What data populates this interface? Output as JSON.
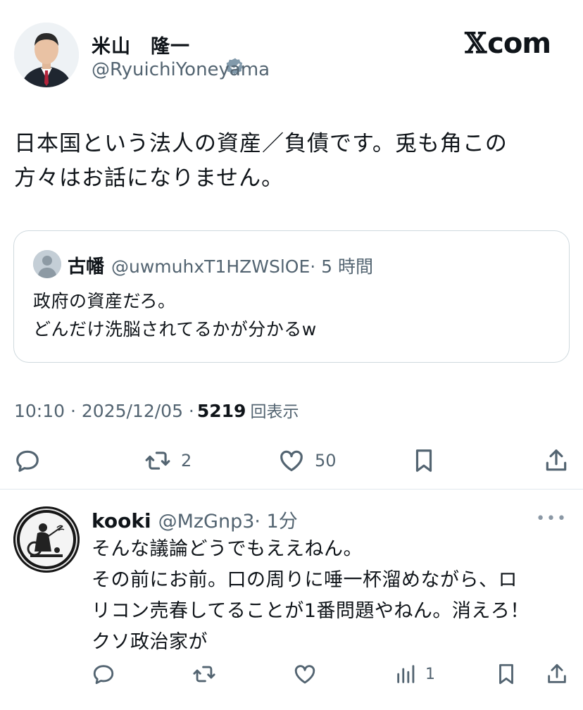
{
  "tweet": {
    "author_name": "米山　隆一",
    "author_handle": "@RyuichiYoneyama",
    "brand": "com",
    "brand_mark": "𝕏",
    "text_line1": "日本国という法人の資産／負債です。兎も角この",
    "text_line2": "方々はお話になりません。",
    "quote": {
      "name": "古幡",
      "handle": "@uwmuhxT1HZWSlOE",
      "time": "· 5 時間",
      "body_line1": "政府の資産だろ。",
      "body_line2": "どんだけ洗脳されてるかが分かるw"
    },
    "timestamp": "10:10 · 2025/12/05 · ",
    "views_count": "5219",
    "views_label": "回表示",
    "actions": {
      "reply_icon": "reply-icon",
      "retweet_icon": "retweet-icon",
      "retweet_count": "2",
      "like_icon": "heart-icon",
      "like_count": "50",
      "bookmark_icon": "bookmark-icon",
      "share_icon": "share-icon"
    }
  },
  "reply": {
    "name": "kooki",
    "handle": "@MzGnp3",
    "time": "· 1分",
    "more": "•••",
    "body_line1": "そんな議論どうでもええねん。",
    "body_line2": "その前にお前。口の周りに唾一杯溜めながら、ロ",
    "body_line3": "リコン売春してることが1番問題やねん。消えろ！",
    "body_line4": "クソ政治家が",
    "views_count": "1"
  },
  "colors": {
    "text": "#0f1419",
    "secondary": "#536471",
    "border": "#cfd9de",
    "verified_badge": "#829aab"
  }
}
